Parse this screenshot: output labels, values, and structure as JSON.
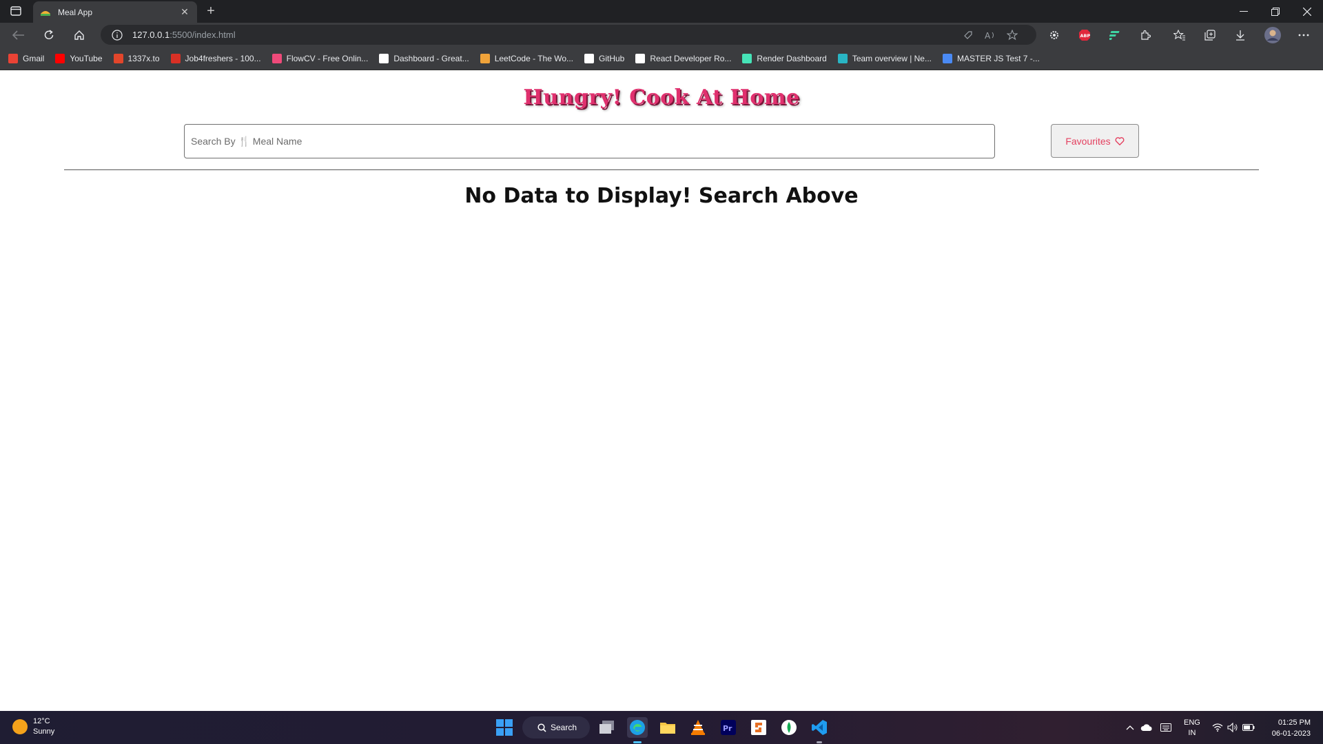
{
  "browser": {
    "tab_title": "Meal App",
    "url_host": "127.0.0.1",
    "url_rest": ":5500/index.html",
    "bookmarks": [
      {
        "label": "Gmail",
        "color": "#ea4335"
      },
      {
        "label": "YouTube",
        "color": "#ff0000"
      },
      {
        "label": "1337x.to",
        "color": "#e2462b"
      },
      {
        "label": "Job4freshers - 100...",
        "color": "#d93025"
      },
      {
        "label": "FlowCV - Free Onlin...",
        "color": "#ef4a7a"
      },
      {
        "label": "Dashboard - Great...",
        "color": "#ffffff"
      },
      {
        "label": "LeetCode - The Wo...",
        "color": "#f0a33a"
      },
      {
        "label": "GitHub",
        "color": "#ffffff"
      },
      {
        "label": "React Developer Ro...",
        "color": "#ffffff"
      },
      {
        "label": "Render Dashboard",
        "color": "#46e3b7"
      },
      {
        "label": "Team overview | Ne...",
        "color": "#29b5c4"
      },
      {
        "label": "MASTER JS Test 7 -...",
        "color": "#4a8af4"
      }
    ]
  },
  "app": {
    "title": "Hungry! Cook At Home",
    "search_placeholder": "Search By 🍴 Meal Name",
    "favourites_label": "Favourites",
    "empty_message": "No Data to Display! Search Above",
    "accent_color": "#e0306e"
  },
  "taskbar": {
    "weather_temp": "12°C",
    "weather_desc": "Sunny",
    "search_label": "Search",
    "lang_top": "ENG",
    "lang_bottom": "IN",
    "time": "01:25 PM",
    "date": "06-01-2023"
  }
}
